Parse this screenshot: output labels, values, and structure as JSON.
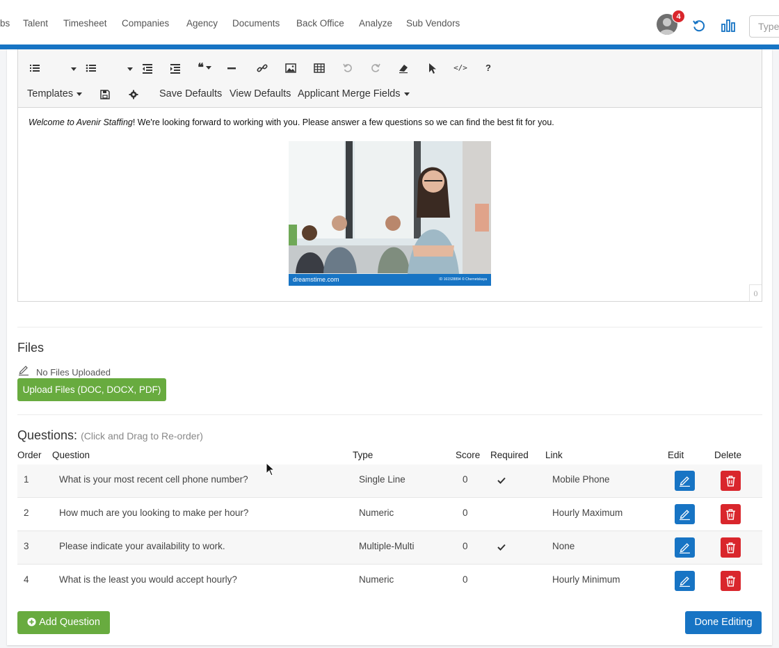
{
  "nav": {
    "items": [
      "bs",
      "Talent",
      "Timesheet",
      "Companies",
      "Agency",
      "Documents",
      "Back Office",
      "Analyze",
      "Sub Vendors"
    ],
    "notification_count": "4",
    "search_placeholder": "Type",
    "accent_color": "#1774c4"
  },
  "editor": {
    "toolbar": {
      "icons": [
        "ordered-list-icon",
        "unordered-list-icon",
        "outdent-icon",
        "indent-icon",
        "blockquote-icon",
        "horizontal-rule-icon",
        "link-icon",
        "image-icon",
        "table-icon",
        "undo-icon",
        "redo-icon",
        "eraser-icon",
        "pointer-icon",
        "code-icon",
        "help-icon"
      ],
      "help_label": "?",
      "code_label": "</>",
      "templates_label": "Templates",
      "save_defaults_label": "Save Defaults",
      "view_defaults_label": "View Defaults",
      "merge_fields_label": "Applicant Merge Fields"
    },
    "content": {
      "italic_text": "Welcome to Avenir Staffing",
      "body_text": "! We're looking forward to working with you. Please answer a few questions so we can find the best fit for you.",
      "image_caption": "dreamstime.com",
      "image_id_text": "ID 161528894 © Chernetskaya"
    },
    "char_count": "0"
  },
  "files": {
    "title": "Files",
    "status": "No Files Uploaded",
    "upload_label": "Upload Files (DOC, DOCX, PDF)"
  },
  "questions": {
    "title": "Questions:",
    "hint": "(Click and Drag to Re-order)",
    "columns": {
      "order": "Order",
      "question": "Question",
      "type": "Type",
      "score": "Score",
      "required": "Required",
      "link": "Link",
      "edit": "Edit",
      "delete": "Delete"
    },
    "rows": [
      {
        "order": "1",
        "question": "What is your most recent cell phone number?",
        "type": "Single Line",
        "score": "0",
        "required": true,
        "link": "Mobile Phone"
      },
      {
        "order": "2",
        "question": "How much are you looking to make per hour?",
        "type": "Numeric",
        "score": "0",
        "required": false,
        "link": "Hourly Maximum"
      },
      {
        "order": "3",
        "question": "Please indicate your availability to work.",
        "type": "Multiple-Multi",
        "score": "0",
        "required": true,
        "link": "None"
      },
      {
        "order": "4",
        "question": "What is the least you would accept hourly?",
        "type": "Numeric",
        "score": "0",
        "required": false,
        "link": "Hourly Minimum"
      }
    ],
    "add_label": "Add Question",
    "done_label": "Done Editing"
  }
}
